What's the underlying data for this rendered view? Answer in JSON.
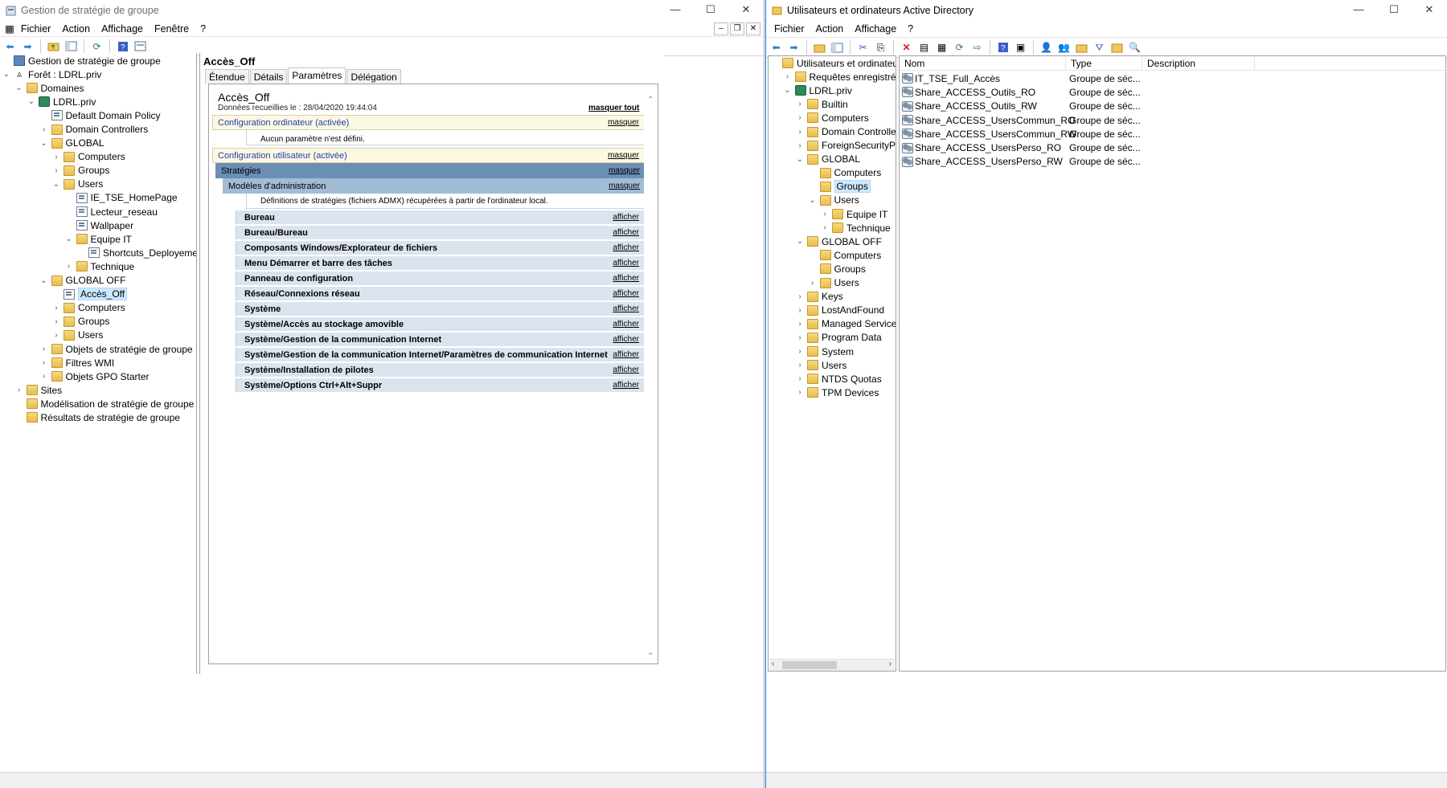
{
  "gpm": {
    "title": "Gestion de stratégie de groupe",
    "menu": [
      "Fichier",
      "Action",
      "Affichage",
      "Fenêtre",
      "?"
    ],
    "tree": [
      {
        "label": "Gestion de stratégie de groupe",
        "level": 0,
        "exp": "",
        "icon": "root"
      },
      {
        "label": "Forêt : LDRL.priv",
        "level": 0,
        "exp": "v",
        "icon": "forest"
      },
      {
        "label": "Domaines",
        "level": 1,
        "exp": "v",
        "icon": "fold"
      },
      {
        "label": "LDRL.priv",
        "level": 2,
        "exp": "v",
        "icon": "dom"
      },
      {
        "label": "Default Domain Policy",
        "level": 3,
        "exp": "",
        "icon": "gpo"
      },
      {
        "label": "Domain Controllers",
        "level": 3,
        "exp": ">",
        "icon": "fold"
      },
      {
        "label": "GLOBAL",
        "level": 3,
        "exp": "v",
        "icon": "fold"
      },
      {
        "label": "Computers",
        "level": 4,
        "exp": ">",
        "icon": "fold"
      },
      {
        "label": "Groups",
        "level": 4,
        "exp": ">",
        "icon": "fold"
      },
      {
        "label": "Users",
        "level": 4,
        "exp": "v",
        "icon": "fold"
      },
      {
        "label": "IE_TSE_HomePage",
        "level": 5,
        "exp": "",
        "icon": "gpo"
      },
      {
        "label": "Lecteur_reseau",
        "level": 5,
        "exp": "",
        "icon": "gpo"
      },
      {
        "label": "Wallpaper",
        "level": 5,
        "exp": "",
        "icon": "gpo"
      },
      {
        "label": "Equipe IT",
        "level": 5,
        "exp": "v",
        "icon": "fold"
      },
      {
        "label": "Shortcuts_Deployement",
        "level": 6,
        "exp": "",
        "icon": "gpo"
      },
      {
        "label": "Technique",
        "level": 5,
        "exp": ">",
        "icon": "fold"
      },
      {
        "label": "GLOBAL OFF",
        "level": 3,
        "exp": "v",
        "icon": "fold"
      },
      {
        "label": "Accès_Off",
        "level": 4,
        "exp": "",
        "icon": "gpo",
        "selected": true
      },
      {
        "label": "Computers",
        "level": 4,
        "exp": ">",
        "icon": "fold"
      },
      {
        "label": "Groups",
        "level": 4,
        "exp": ">",
        "icon": "fold"
      },
      {
        "label": "Users",
        "level": 4,
        "exp": ">",
        "icon": "fold"
      },
      {
        "label": "Objets de stratégie de groupe",
        "level": 3,
        "exp": ">",
        "icon": "fold"
      },
      {
        "label": "Filtres WMI",
        "level": 3,
        "exp": ">",
        "icon": "fold"
      },
      {
        "label": "Objets GPO Starter",
        "level": 3,
        "exp": ">",
        "icon": "fold"
      },
      {
        "label": "Sites",
        "level": 1,
        "exp": ">",
        "icon": "fold"
      },
      {
        "label": "Modélisation de stratégie de groupe",
        "level": 1,
        "exp": "",
        "icon": "fold"
      },
      {
        "label": "Résultats de stratégie de groupe",
        "level": 1,
        "exp": "",
        "icon": "fold"
      }
    ],
    "pane_title": "Accès_Off",
    "tabs": [
      "Étendue",
      "Détails",
      "Paramètres",
      "Délégation"
    ],
    "active_tab": 2,
    "report": {
      "title": "Accès_Off",
      "date": "Données recueillies le : 28/04/2020 19:44:04",
      "hide_all": "masquer tout",
      "computer_config": "Configuration ordinateur (activée)",
      "no_setting": "Aucun paramètre n'est défini.",
      "user_config": "Configuration utilisateur (activée)",
      "strategies": "Stratégies",
      "admin_templates": "Modèles d'administration",
      "admx_note": "Définitions de stratégies (fichiers ADMX) récupérées à partir de l'ordinateur local.",
      "hide": "masquer",
      "show": "afficher",
      "items": [
        "Bureau",
        "Bureau/Bureau",
        "Composants Windows/Explorateur de fichiers",
        "Menu Démarrer et barre des tâches",
        "Panneau de configuration",
        "Réseau/Connexions réseau",
        "Système",
        "Système/Accès au stockage amovible",
        "Système/Gestion de la communication Internet",
        "Système/Gestion de la communication Internet/Paramètres de communication Internet",
        "Système/Installation de pilotes",
        "Système/Options Ctrl+Alt+Suppr"
      ]
    }
  },
  "ad": {
    "title": "Utilisateurs et ordinateurs Active Directory",
    "menu": [
      "Fichier",
      "Action",
      "Affichage",
      "?"
    ],
    "tree": [
      {
        "label": "Utilisateurs et ordinateurs Active",
        "level": 0,
        "exp": "",
        "icon": "fold"
      },
      {
        "label": "Requêtes enregistrées",
        "level": 1,
        "exp": ">",
        "icon": "fold"
      },
      {
        "label": "LDRL.priv",
        "level": 1,
        "exp": "v",
        "icon": "dom"
      },
      {
        "label": "Builtin",
        "level": 2,
        "exp": ">",
        "icon": "fold"
      },
      {
        "label": "Computers",
        "level": 2,
        "exp": ">",
        "icon": "fold"
      },
      {
        "label": "Domain Controllers",
        "level": 2,
        "exp": ">",
        "icon": "fold"
      },
      {
        "label": "ForeignSecurityPrincipals",
        "level": 2,
        "exp": ">",
        "icon": "fold"
      },
      {
        "label": "GLOBAL",
        "level": 2,
        "exp": "v",
        "icon": "fold"
      },
      {
        "label": "Computers",
        "level": 3,
        "exp": "",
        "icon": "fold"
      },
      {
        "label": "Groups",
        "level": 3,
        "exp": "",
        "icon": "fold",
        "selected": true
      },
      {
        "label": "Users",
        "level": 3,
        "exp": "v",
        "icon": "fold"
      },
      {
        "label": "Equipe IT",
        "level": 4,
        "exp": ">",
        "icon": "fold"
      },
      {
        "label": "Technique",
        "level": 4,
        "exp": ">",
        "icon": "fold"
      },
      {
        "label": "GLOBAL OFF",
        "level": 2,
        "exp": "v",
        "icon": "fold"
      },
      {
        "label": "Computers",
        "level": 3,
        "exp": "",
        "icon": "fold"
      },
      {
        "label": "Groups",
        "level": 3,
        "exp": "",
        "icon": "fold"
      },
      {
        "label": "Users",
        "level": 3,
        "exp": ">",
        "icon": "fold"
      },
      {
        "label": "Keys",
        "level": 2,
        "exp": ">",
        "icon": "fold"
      },
      {
        "label": "LostAndFound",
        "level": 2,
        "exp": ">",
        "icon": "fold"
      },
      {
        "label": "Managed Service Accour",
        "level": 2,
        "exp": ">",
        "icon": "fold"
      },
      {
        "label": "Program Data",
        "level": 2,
        "exp": ">",
        "icon": "fold"
      },
      {
        "label": "System",
        "level": 2,
        "exp": ">",
        "icon": "fold"
      },
      {
        "label": "Users",
        "level": 2,
        "exp": ">",
        "icon": "fold"
      },
      {
        "label": "NTDS Quotas",
        "level": 2,
        "exp": ">",
        "icon": "fold"
      },
      {
        "label": "TPM Devices",
        "level": 2,
        "exp": ">",
        "icon": "fold"
      }
    ],
    "columns": [
      "Nom",
      "Type",
      "Description"
    ],
    "rows": [
      {
        "name": "IT_TSE_Full_Accès",
        "type": "Groupe de séc..."
      },
      {
        "name": "Share_ACCESS_Outils_RO",
        "type": "Groupe de séc..."
      },
      {
        "name": "Share_ACCESS_Outils_RW",
        "type": "Groupe de séc..."
      },
      {
        "name": "Share_ACCESS_UsersCommun_RO",
        "type": "Groupe de séc..."
      },
      {
        "name": "Share_ACCESS_UsersCommun_RW",
        "type": "Groupe de séc..."
      },
      {
        "name": "Share_ACCESS_UsersPerso_RO",
        "type": "Groupe de séc..."
      },
      {
        "name": "Share_ACCESS_UsersPerso_RW",
        "type": "Groupe de séc..."
      }
    ]
  }
}
